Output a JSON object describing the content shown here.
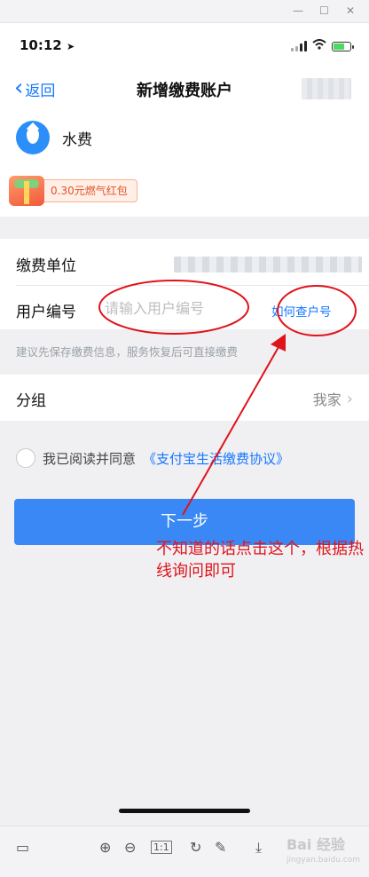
{
  "window": {
    "minimize_glyph": "—",
    "maximize_glyph": "☐",
    "close_glyph": "✕"
  },
  "status_bar": {
    "time": "10:12",
    "location_glyph": "➤"
  },
  "nav": {
    "back_label": "返回",
    "title": "新增缴费账户"
  },
  "service": {
    "name": "水费",
    "icon": "water-drop-icon"
  },
  "promo": {
    "label": "0.30元燃气红包"
  },
  "form": {
    "unit_label": "缴费单位",
    "user_no_label": "用户编号",
    "user_no_placeholder": "请输入用户编号",
    "howto_link": "如何查户号",
    "hint": "建议先保存缴费信息，服务恢复后可直接缴费"
  },
  "group": {
    "label": "分组",
    "value": "我家"
  },
  "agreement": {
    "prefix": "我已阅读并同意",
    "link": "《支付宝生活缴费协议》"
  },
  "next_button": "下一步",
  "annotation": {
    "text": "不知道的话点击这个，根据热线询问即可",
    "color": "#e0131b"
  },
  "toolbar": {
    "zoom_in": "⊕",
    "zoom_out": "⊖",
    "actual_size": "1:1",
    "rotate": "↻",
    "edit": "✎",
    "download": "⤓",
    "panel": "▭"
  },
  "watermark": {
    "text": "Bai 经验",
    "sub": "jingyan.baidu.com"
  },
  "colors": {
    "accent": "#1677ff",
    "button": "#3a88f5",
    "annotation": "#e0131b"
  }
}
